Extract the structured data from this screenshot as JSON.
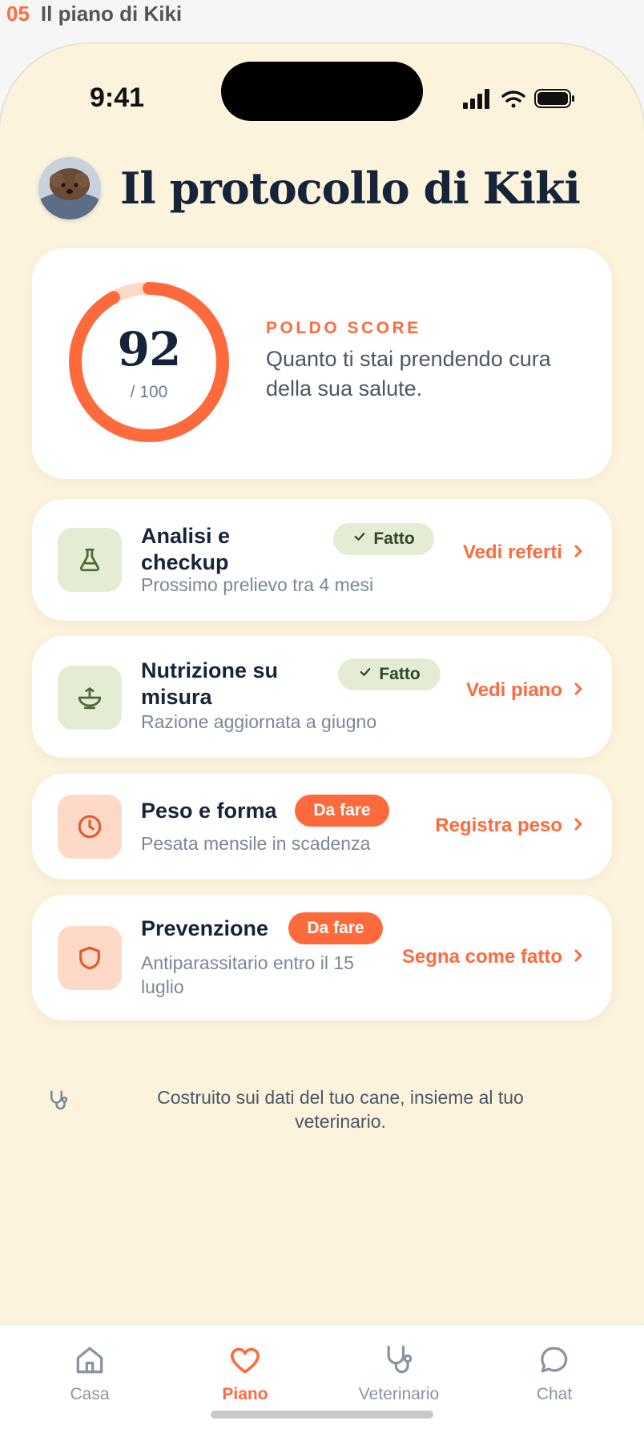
{
  "screen": {
    "number": "05",
    "title": "Il piano di Kiki"
  },
  "status_bar": {
    "time": "9:41"
  },
  "header": {
    "title": "Il protocollo di Kiki"
  },
  "score": {
    "value": "92",
    "max": "/ 100",
    "fraction": 0.92,
    "label": "POLDO SCORE",
    "description": "Quanto ti stai prendendo cura della sua salute."
  },
  "tasks": [
    {
      "title": "Analisi e checkup",
      "subtitle": "Prossimo prelievo tra 4 mesi",
      "badge": "Fatto",
      "status": "done",
      "icon": "flask-icon",
      "action": "Vedi referti"
    },
    {
      "title": "Nutrizione su misura",
      "subtitle": "Razione aggiornata a giugno",
      "badge": "Fatto",
      "status": "done",
      "icon": "bowl-icon",
      "action": "Vedi piano"
    },
    {
      "title": "Peso e forma",
      "subtitle": "Pesata mensile in scadenza",
      "badge": "Da fare",
      "status": "todo",
      "icon": "clock-icon",
      "action": "Registra peso"
    },
    {
      "title": "Prevenzione",
      "subtitle": "Antiparassitario entro il 15 luglio",
      "badge": "Da fare",
      "status": "todo",
      "icon": "shield-icon",
      "action": "Segna come fatto"
    }
  ],
  "footnote": {
    "text": "Costruito sui dati del tuo cane, insieme al tuo veterinario.",
    "icon": "stethoscope-icon"
  },
  "tabs": [
    {
      "label": "Casa",
      "icon": "home-icon",
      "active": false
    },
    {
      "label": "Piano",
      "icon": "heart-icon",
      "active": true
    },
    {
      "label": "Veterinario",
      "icon": "stethoscope-icon",
      "active": false
    },
    {
      "label": "Chat",
      "icon": "chat-icon",
      "active": false
    }
  ],
  "colors": {
    "accent": "#ff6a3d",
    "background": "#fcf3dd",
    "done_badge": "#e4edd4",
    "todo_icon_bg": "#ffd9c7",
    "text_dark": "#16243a"
  }
}
